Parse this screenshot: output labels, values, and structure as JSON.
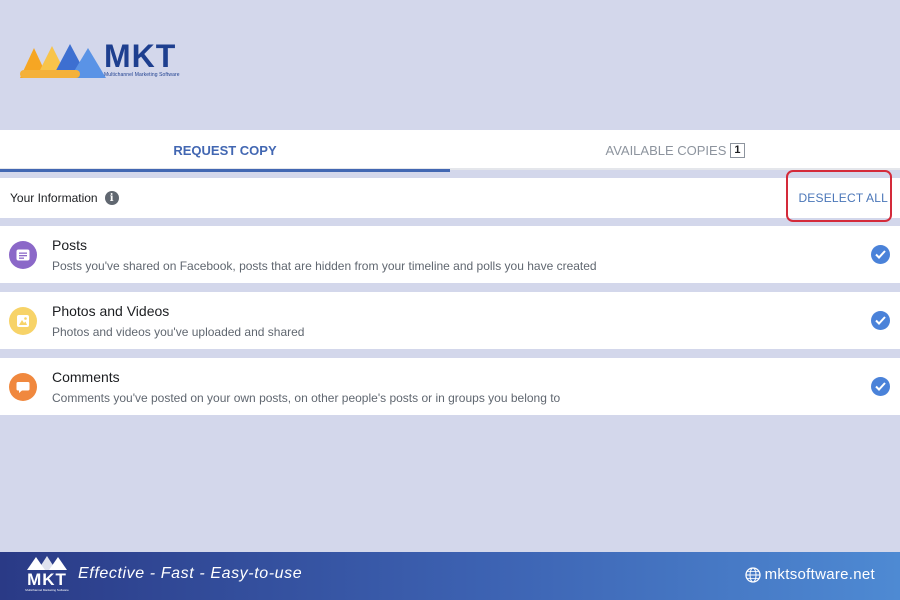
{
  "brand": {
    "name": "MKT",
    "tagline": "Multichannel Marketing Software"
  },
  "tabs": [
    {
      "label": "REQUEST COPY",
      "active": true
    },
    {
      "label": "AVAILABLE COPIES",
      "count": "1",
      "active": false
    }
  ],
  "info_bar": {
    "label": "Your Information",
    "info_icon": "i",
    "action_label": "DESELECT ALL",
    "highlight_color": "#d42a3a"
  },
  "items": [
    {
      "title": "Posts",
      "description": "Posts you've shared on Facebook, posts that are hidden from your timeline and polls you have created",
      "icon": "post-icon",
      "icon_color": "#8b68c8",
      "checked": true
    },
    {
      "title": "Photos and Videos",
      "description": "Photos and videos you've uploaded and shared",
      "icon": "photo-icon",
      "icon_color": "#f7d368",
      "checked": true
    },
    {
      "title": "Comments",
      "description": "Comments you've posted on your own posts, on other people's posts or in groups you belong to",
      "icon": "comment-icon",
      "icon_color": "#f0883e",
      "checked": true
    }
  ],
  "footer": {
    "slogan": "Effective - Fast - Easy-to-use",
    "website": "mktsoftware.net",
    "logo_word": "MKT",
    "logo_tag": "Multichannel Marketing Software"
  }
}
